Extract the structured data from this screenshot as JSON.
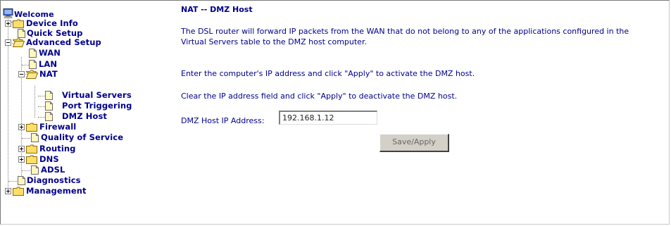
{
  "nav": {
    "welcome": "Welcome",
    "device_info": "Device Info",
    "quick_setup": "Quick Setup",
    "advanced_setup": "Advanced Setup",
    "wan": "WAN",
    "lan": "LAN",
    "nat": "NAT",
    "virtual_servers": "Virtual Servers",
    "port_triggering": "Port Triggering",
    "dmz_host": "DMZ Host",
    "firewall": "Firewall",
    "qos": "Quality of Service",
    "routing": "Routing",
    "dns": "DNS",
    "adsl": "ADSL",
    "diagnostics": "Diagnostics",
    "management": "Management"
  },
  "main": {
    "title": "NAT -- DMZ Host",
    "para1_line1": "The DSL router will forward IP packets from the WAN that do not belong to any of the applications configured in the",
    "para1_line2": "Virtual Servers table to the DMZ host computer.",
    "para2": "Enter the computer's IP address and click \"Apply\" to activate the DMZ host.",
    "para3": "Clear the IP address field and click \"Apply\" to deactivate the DMZ host.",
    "ip_label": "DMZ Host IP Address:",
    "ip_value": "192.168.1.12",
    "save_button": "Save/Apply"
  }
}
